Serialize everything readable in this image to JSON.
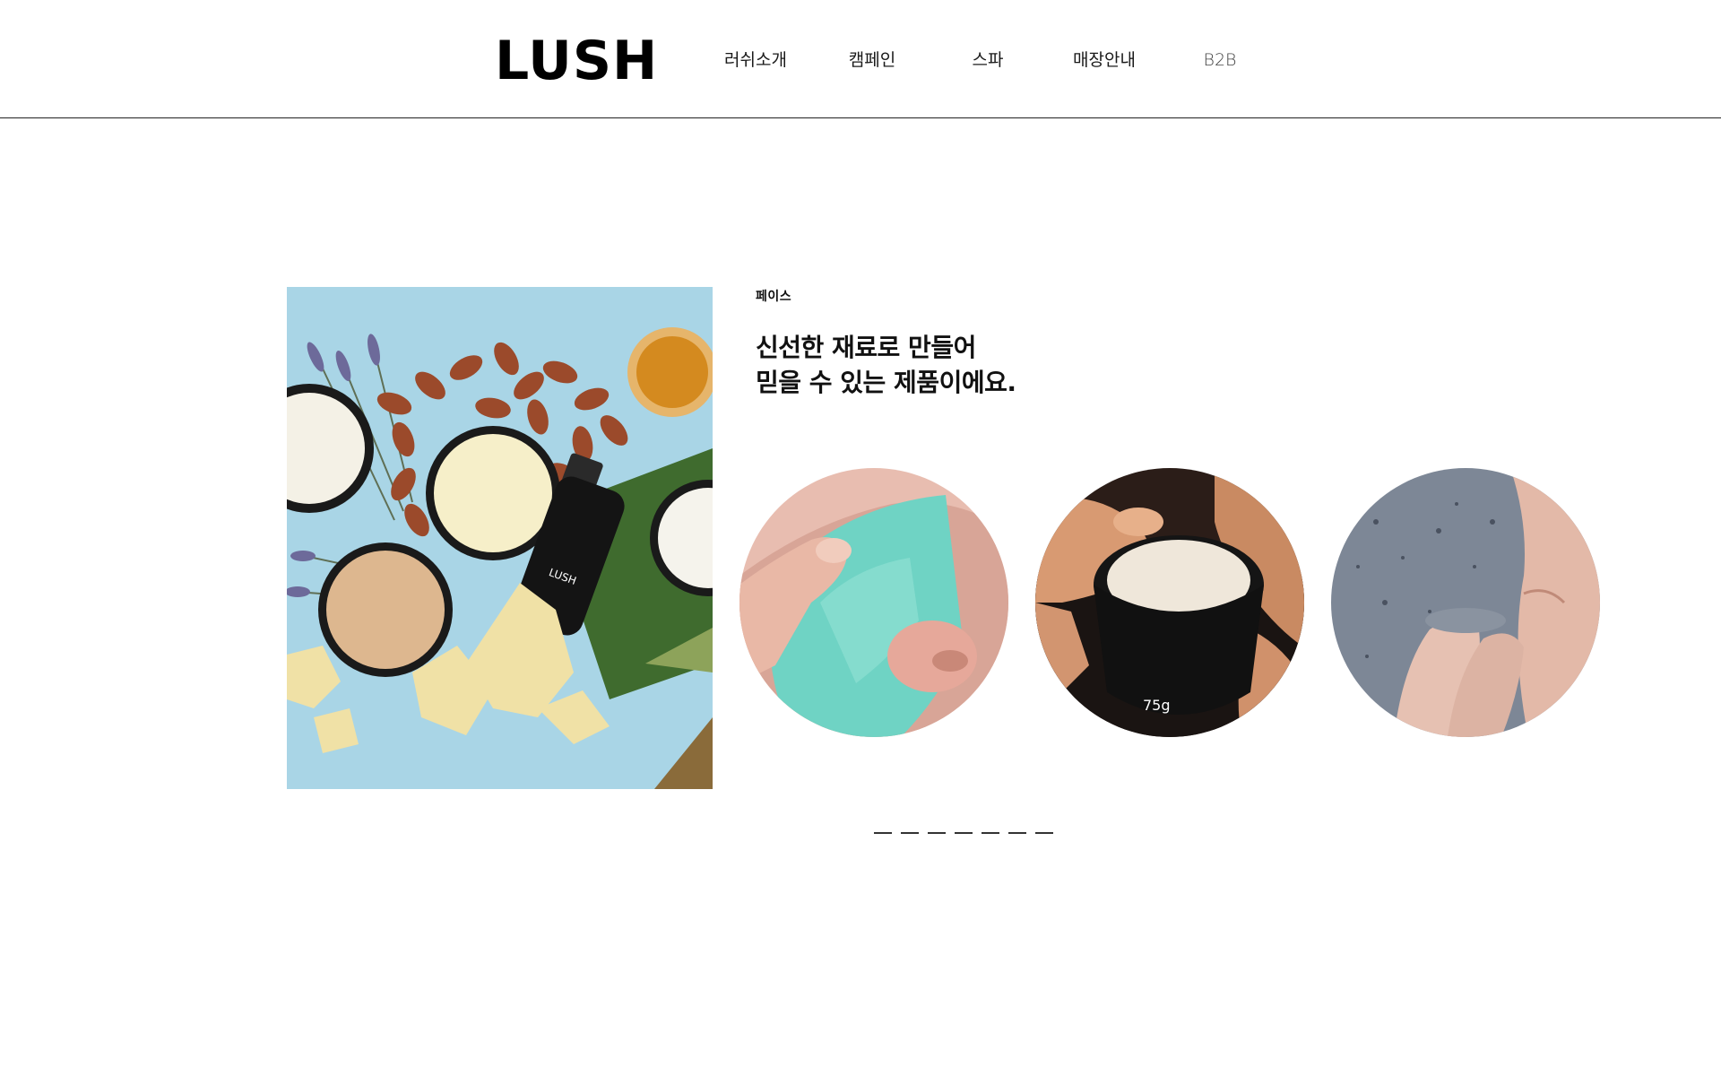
{
  "header": {
    "logo": "LUSH",
    "nav": [
      {
        "label": "러쉬소개"
      },
      {
        "label": "캠페인"
      },
      {
        "label": "스파"
      },
      {
        "label": "매장안내"
      },
      {
        "label": "B2B"
      }
    ]
  },
  "feature": {
    "category": "페이스",
    "headline_line1": "신선한 재료로 만들어",
    "headline_line2": "믿을 수 있는 제품이에요."
  },
  "pagination": {
    "count": 7
  },
  "colors": {
    "hero_background": "#a9d5e6",
    "mask_teal": "#6fd3c4",
    "mask_grey": "#7d8796"
  }
}
